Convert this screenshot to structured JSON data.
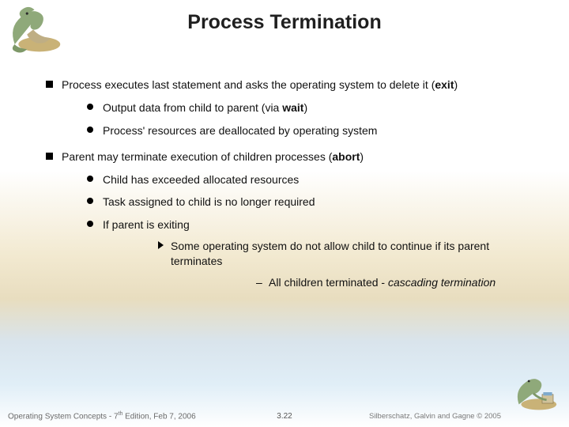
{
  "title": "Process Termination",
  "bullets": {
    "p1": "Process executes last statement and asks the operating system to delete it (",
    "p1_kw": "exit",
    "p1_end": ")",
    "p1a": "Output data from child to parent (via ",
    "p1a_kw": "wait",
    "p1a_end": ")",
    "p1b": "Process' resources are deallocated by operating system",
    "p2": "Parent may terminate execution of children processes (",
    "p2_kw": "abort",
    "p2_end": ")",
    "p2a": "Child has exceeded allocated resources",
    "p2b": "Task assigned to child is no longer required",
    "p2c": "If parent is exiting",
    "p2c1": "Some operating system do not allow child to continue if its parent terminates",
    "p2c1a_pre": "All children terminated - ",
    "p2c1a_em": "cascading termination"
  },
  "footer": {
    "left_pre": "Operating System Concepts - 7",
    "left_sup": "th",
    "left_post": " Edition, Feb 7, 2006",
    "center": "3.22",
    "right": "Silberschatz, Galvin and Gagne © 2005"
  }
}
